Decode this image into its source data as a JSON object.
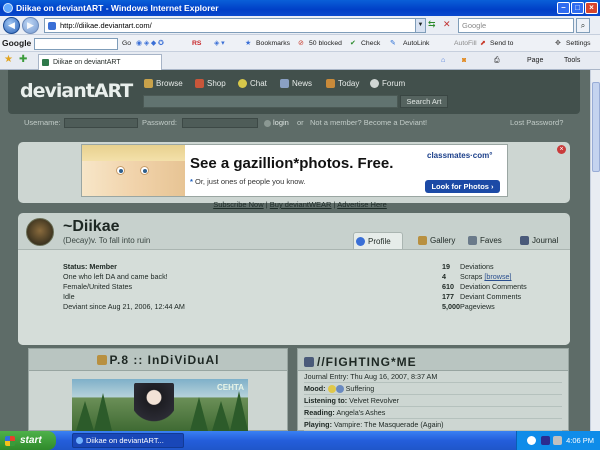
{
  "window": {
    "title": "Diikae on deviantART - Windows Internet Explorer"
  },
  "address": {
    "url": "http://diikae.deviantart.com/",
    "search_placeholder": "Google"
  },
  "google_toolbar": {
    "brand": "Google",
    "go": "Go",
    "rs": "RS",
    "bookmarks": "Bookmarks",
    "blocked": "50 blocked",
    "check": "Check",
    "autolink": "AutoLink",
    "autofill": "AutoFill",
    "sendto": "Send to",
    "settings": "Settings"
  },
  "tabs": {
    "active": "Diikae on deviantART",
    "page": "Page",
    "tools": "Tools"
  },
  "site": {
    "logo": "deviantART",
    "nav": [
      "Browse",
      "Shop",
      "Chat",
      "News",
      "Today",
      "Forum"
    ],
    "search_button": "Search Art",
    "login": {
      "username_label": "Username:",
      "password_label": "Password:",
      "login_button": "login",
      "or": "or",
      "become": "Not a member? Become a Deviant!",
      "lost": "Lost Password?"
    }
  },
  "ad": {
    "headline": "See a gazillion*photos. Free.",
    "sub_star": "*",
    "sub": "Or, just ones of people you know.",
    "brand": "classmates·com°",
    "button": "Look for Photos ›",
    "close": "×"
  },
  "ad_links": {
    "subscribe": "Subscribe Now",
    "sep": "|",
    "wear": "Buy deviantWEAR",
    "advertise": "Advertise Here"
  },
  "profile": {
    "name": "~Diikae",
    "tagline": "(Decay)v. To fall into ruin",
    "tabs": [
      "Profile",
      "Gallery",
      "Faves",
      "Journal"
    ],
    "status_label": "Status:",
    "status": "Member",
    "info": [
      "One who left DA and came back!",
      "Female/United States",
      "Idle",
      "Deviant since Aug 21, 2006, 12:44 AM"
    ],
    "stats": [
      {
        "num": "19",
        "label": "Deviations"
      },
      {
        "num": "4",
        "label": "Scraps",
        "link": "[browse]"
      },
      {
        "num": "610",
        "label": "Deviation Comments"
      },
      {
        "num": "177",
        "label": "Deviant Comments"
      },
      {
        "num": "5,000",
        "label": "Pageviews"
      }
    ]
  },
  "deviation": {
    "title": "P.8 :: InDiViDuAl",
    "overlay": "CEHTA"
  },
  "journal": {
    "title": "//FIGHTING*ME",
    "entry": "Journal Entry: Thu Aug 16, 2007, 8:37 AM",
    "rows": [
      {
        "label": "Mood:",
        "value": "Suffering"
      },
      {
        "label": "Listening to:",
        "value": "Velvet Revolver"
      },
      {
        "label": "Reading:",
        "value": "Angela's Ashes"
      },
      {
        "label": "Playing:",
        "value": "Vampire: The Masquerade (Again)"
      }
    ]
  },
  "taskbar": {
    "start": "start",
    "task": "Diikae on deviantART...",
    "clock": "4:06 PM"
  }
}
